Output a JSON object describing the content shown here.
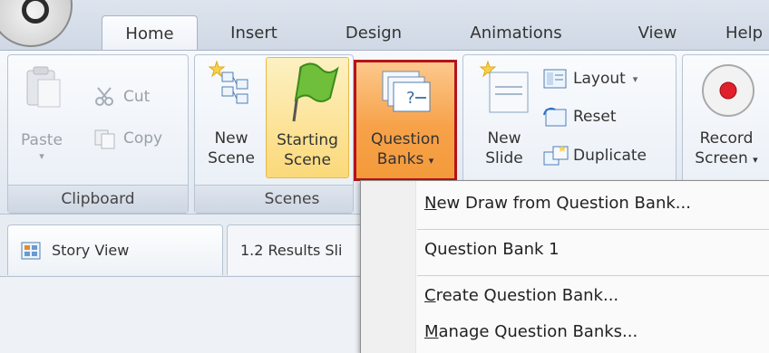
{
  "tabs": [
    "Home",
    "Insert",
    "Design",
    "Animations",
    "View",
    "Help"
  ],
  "clipboard": {
    "paste_label": "Paste",
    "cut_label": "Cut",
    "copy_label": "Copy",
    "group_label": "Clipboard"
  },
  "scenes": {
    "new_scene": [
      "New",
      "Scene"
    ],
    "starting_scene": [
      "Starting",
      "Scene"
    ],
    "question_banks": [
      "Question",
      "Banks"
    ],
    "group_label": "Scenes"
  },
  "slides": {
    "new_slide": [
      "New",
      "Slide"
    ],
    "layout_label": "Layout",
    "reset_label": "Reset",
    "duplicate_label": "Duplicate"
  },
  "record": {
    "label": [
      "Record",
      "Screen"
    ]
  },
  "view_tabs": [
    "Story View",
    "1.2 Results Sli"
  ],
  "dropdown": {
    "items": [
      {
        "prefix": "",
        "accel": "N",
        "rest": "ew Draw from Question Bank..."
      },
      {
        "prefix": "",
        "accel": "",
        "rest": "Question Bank 1"
      },
      {
        "prefix": "",
        "accel": "C",
        "rest": "reate Question Bank..."
      },
      {
        "prefix": "",
        "accel": "M",
        "rest": "anage Question Banks..."
      }
    ]
  },
  "colors": {
    "highlight_border": "#b3141b",
    "orange_button": "#f7a24a",
    "starting_scene_bg": "#fbe39a"
  }
}
